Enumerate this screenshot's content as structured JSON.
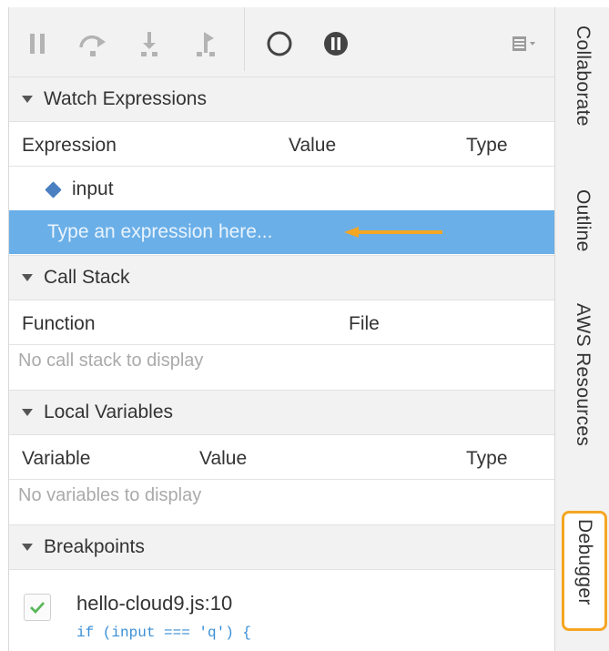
{
  "toolbar": {
    "buttons": [
      {
        "name": "pause-icon"
      },
      {
        "name": "step-over-icon"
      },
      {
        "name": "step-into-icon"
      },
      {
        "name": "step-out-icon"
      },
      {
        "name": "deactivate-breakpoints-icon"
      },
      {
        "name": "pause-on-exceptions-icon"
      },
      {
        "name": "debugger-settings-icon"
      }
    ]
  },
  "watch": {
    "title": "Watch Expressions",
    "columns": {
      "expression": "Expression",
      "value": "Value",
      "type": "Type"
    },
    "items": [
      {
        "expression": "input"
      }
    ],
    "placeholder": "Type an expression here..."
  },
  "call_stack": {
    "title": "Call Stack",
    "columns": {
      "function": "Function",
      "file": "File"
    },
    "empty": "No call stack to display"
  },
  "locals": {
    "title": "Local Variables",
    "columns": {
      "variable": "Variable",
      "value": "Value",
      "type": "Type"
    },
    "empty": "No variables to display"
  },
  "breakpoints": {
    "title": "Breakpoints",
    "items": [
      {
        "file": "hello-cloud9.js:10",
        "code": "if (input === 'q') {",
        "enabled": true
      }
    ]
  },
  "side_tabs": [
    "Collaborate",
    "Outline",
    "AWS Resources",
    "Debugger"
  ],
  "colors": {
    "accent": "#6aafe8",
    "highlight": "#f5a623",
    "code": "#3a8fd6"
  }
}
